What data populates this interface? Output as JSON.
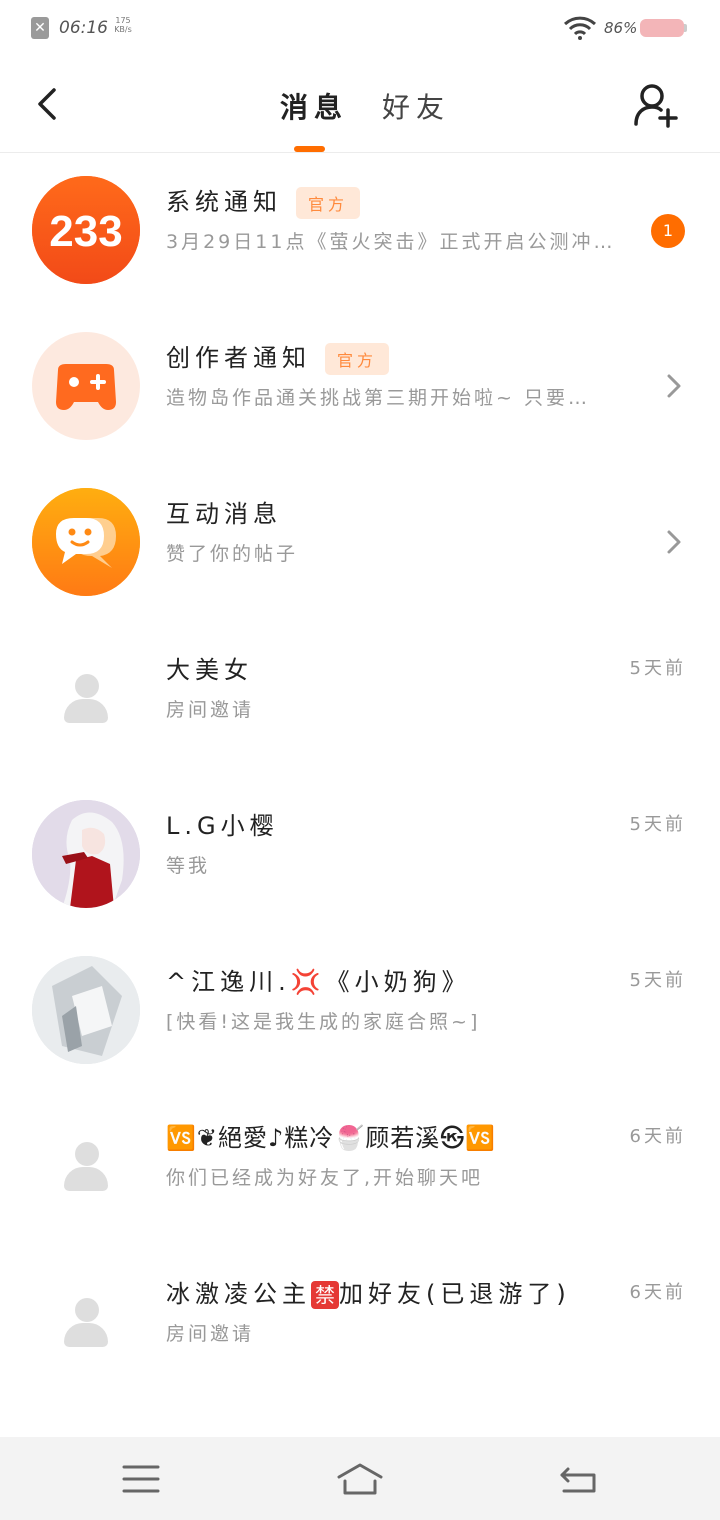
{
  "status_bar": {
    "time": "06:16",
    "net_speed_value": "175",
    "net_speed_unit": "KB/s",
    "battery_percent": "86%"
  },
  "header": {
    "tabs": [
      {
        "label": "消息",
        "active": true
      },
      {
        "label": "好友",
        "active": false
      }
    ]
  },
  "colors": {
    "accent": "#ff6d00",
    "official_badge_bg": "#ffe8d8",
    "official_badge_text": "#ff8a3d"
  },
  "messages": [
    {
      "title": "系统通知",
      "badge": "官方",
      "subtitle": "3月29日11点《萤火突击》正式开启公测冲刺…",
      "unread": "1",
      "icon": "233-logo"
    },
    {
      "title": "创作者通知",
      "badge": "官方",
      "subtitle": "造物岛作品通关挑战第三期开始啦~  只要…",
      "icon": "gamepad-icon"
    },
    {
      "title": "互动消息",
      "subtitle": "赞了你的帖子",
      "icon": "chat-bubble-icon"
    },
    {
      "title": "大美女",
      "subtitle": "房间邀请",
      "time": "5天前"
    },
    {
      "title": "L.G小樱",
      "subtitle": "等我",
      "time": "5天前"
    },
    {
      "title_prefix": "^江逸川.",
      "title_emoji": "💢",
      "title_suffix": "《小奶狗》",
      "subtitle": "[快看!这是我生成的家庭合照~]",
      "time": "5天前"
    },
    {
      "title": "🆚❦絕愛♪糕冷🍧顾若溪㉿🆚",
      "subtitle": "你们已经成为好友了,开始聊天吧",
      "time": "6天前"
    },
    {
      "title_prefix": "冰激凌公主",
      "title_emoji": "禁",
      "title_suffix": "加好友(已退游了)",
      "subtitle": "房间邀请",
      "time": "6天前"
    }
  ],
  "nav_bar": {
    "icons": [
      "menu-icon",
      "home-icon",
      "back-icon"
    ]
  }
}
